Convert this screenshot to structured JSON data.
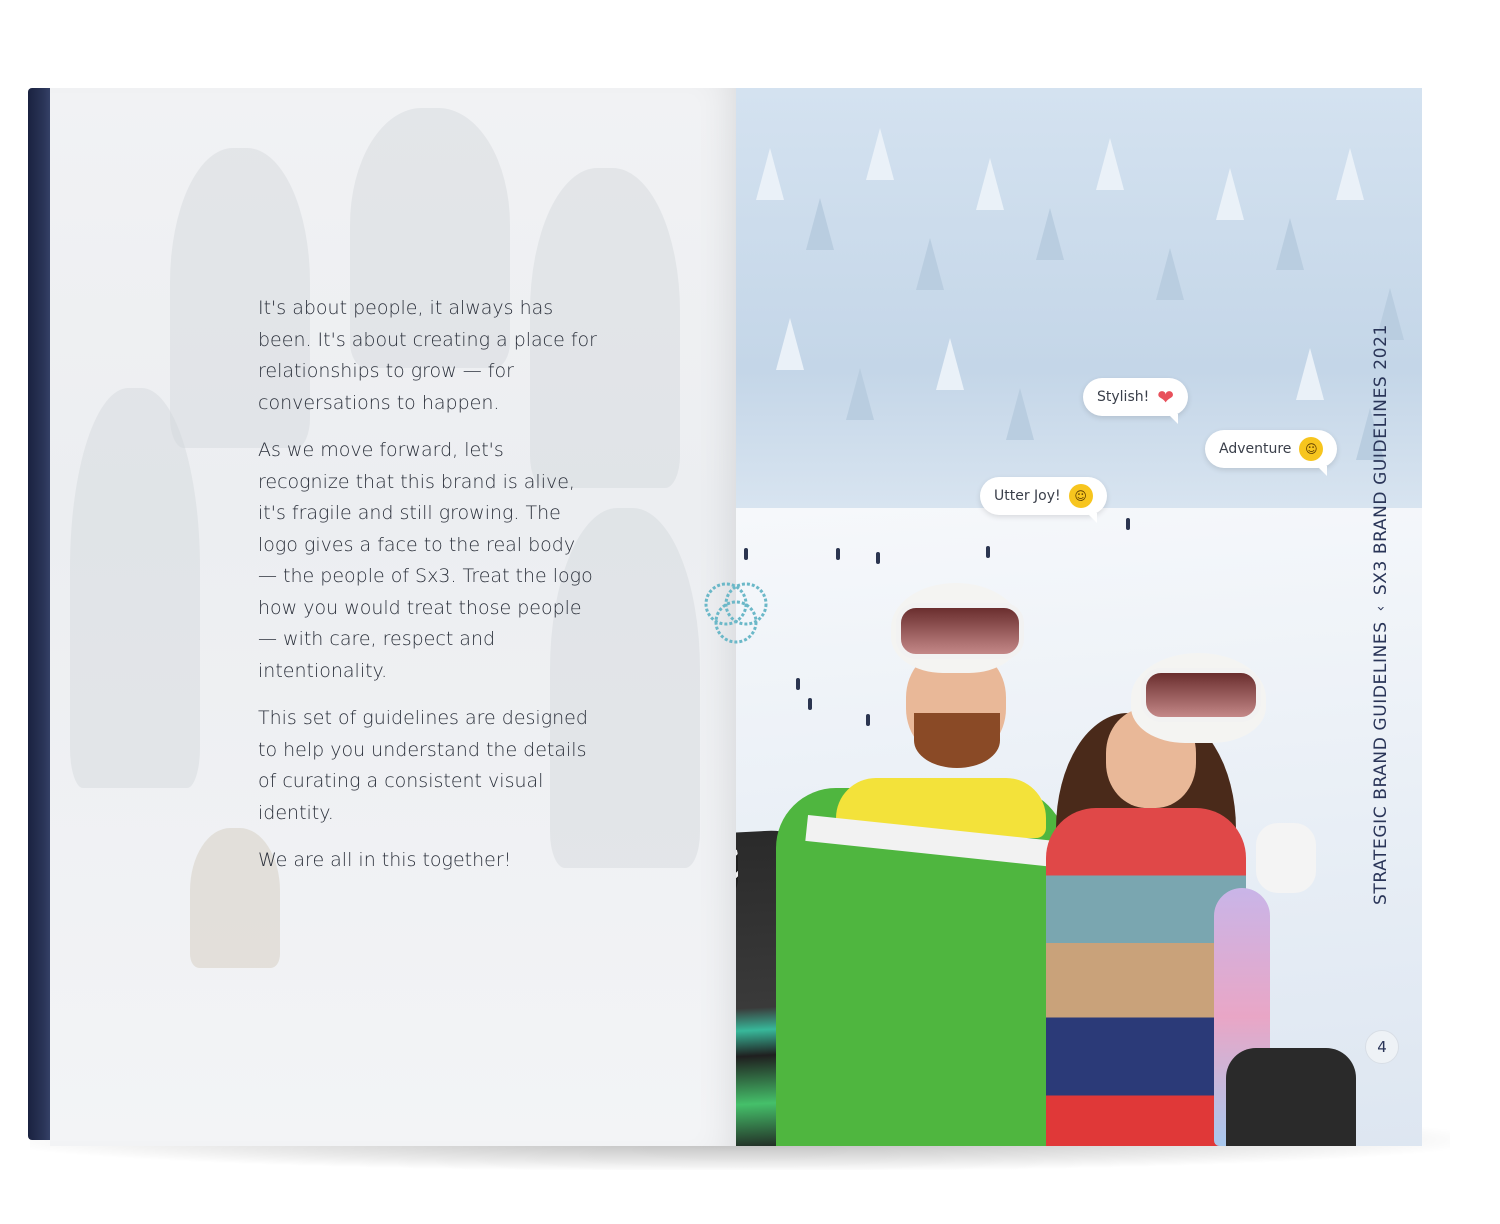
{
  "spread": {
    "left_page": {
      "paragraphs": [
        "It's about people, it always has been. It's about creating a place for relationships to grow — for conversations to happen.",
        "As we move forward, let's recognize that this brand is alive, it's fragile and still growing. The logo gives a face to the real body — the people of Sx3. Treat the logo how you would treat those people — with care, respect and intentionality.",
        "This set of guidelines are designed to help you understand the details of curating a consistent visual identity.",
        "We are all in this together!"
      ]
    },
    "right_page": {
      "bubbles": [
        {
          "text": "Stylish!",
          "icon": "heart-icon"
        },
        {
          "text": "Adventure",
          "icon": "grinning-emoji-icon"
        },
        {
          "text": "Utter Joy!",
          "icon": "laughing-emoji-icon"
        }
      ],
      "vertical_title_left": "STRATEGIC BRAND GUIDELINES",
      "vertical_title_separator": "‹",
      "vertical_title_right": "SX3 BRAND GUIDELINES 2021",
      "page_number": "4"
    }
  },
  "colors": {
    "cover": "#1a2240",
    "text": "#2a2f3a",
    "title": "#2a3558",
    "logo_ring": "#6bb8c8",
    "emoji": "#f7c51e",
    "heart": "#e8505b"
  }
}
